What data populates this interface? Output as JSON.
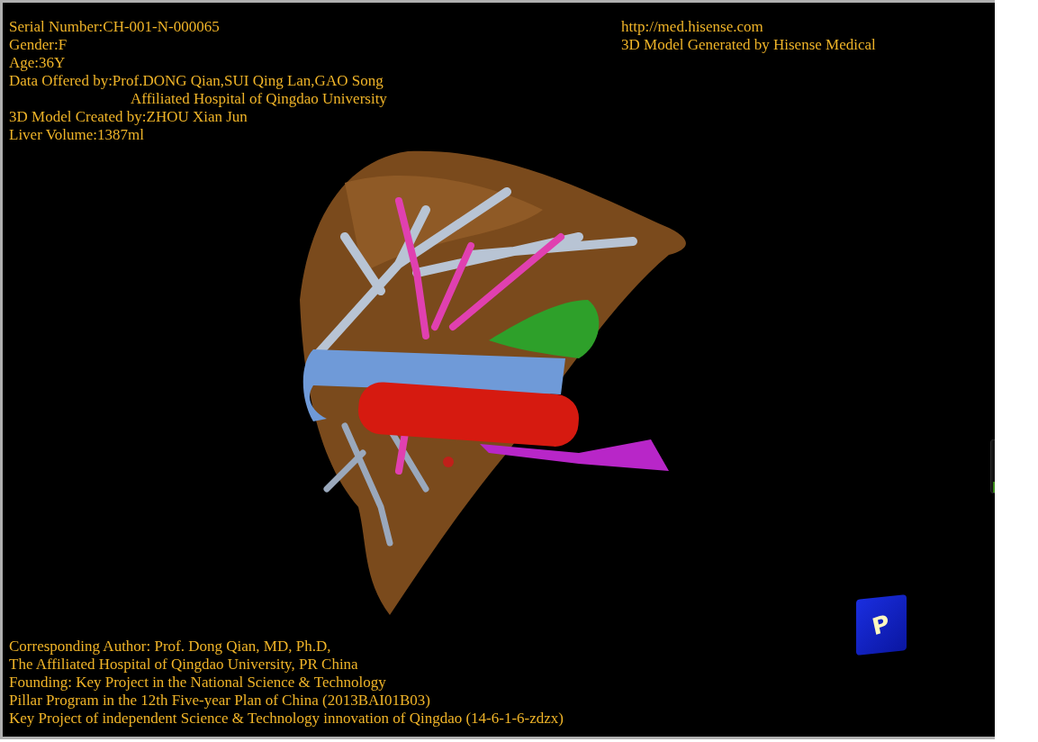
{
  "info_top_left": [
    {
      "text": "Serial Number:CH-001-N-000065",
      "kind": "line"
    },
    {
      "text": "Gender:F",
      "kind": "line"
    },
    {
      "text": "Age:36Y",
      "kind": "line"
    },
    {
      "text": "Data Offered by:Prof.DONG Qian,SUI Qing Lan,GAO Song",
      "kind": "line"
    },
    {
      "text": "Affiliated Hospital of Qingdao University",
      "kind": "continuation"
    },
    {
      "text": "3D Model Created by:ZHOU Xian Jun",
      "kind": "line"
    },
    {
      "text": "Liver Volume:1387ml",
      "kind": "line"
    }
  ],
  "info_top_right": [
    "http://med.hisense.com",
    "3D Model Generated by Hisense Medical"
  ],
  "info_bottom": [
    "Corresponding Author: Prof. Dong Qian, MD, Ph.D,",
    "The Affiliated Hospital of Qingdao University, PR China",
    "Founding: Key Project in the National Science & Technology",
    "Pillar Program in the 12th Five-year Plan of China (2013BAI01B03)",
    "Key Project of independent Science & Technology innovation of Qingdao (14-6-1-6-zdzx)"
  ],
  "orientation_cube": {
    "label": "P"
  },
  "side_slider": {
    "level": 0.2
  }
}
